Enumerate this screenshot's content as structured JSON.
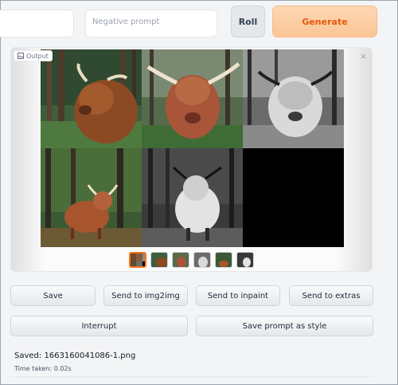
{
  "top_bar": {
    "negative_prompt_placeholder": "Negative prompt",
    "roll_label": "Roll",
    "generate_label": "Generate"
  },
  "output": {
    "label": "Output",
    "close_icon": "×",
    "image_count": 6,
    "selected_thumbnail": 1
  },
  "actions": {
    "save": "Save",
    "send_img2img": "Send to img2img",
    "send_inpaint": "Send to inpaint",
    "send_extras": "Send to extras",
    "interrupt": "Interrupt",
    "save_prompt_style": "Save prompt as style"
  },
  "info": {
    "saved": "Saved: 1663160041086-1.png",
    "time_taken": "Time taken: 0.02s"
  },
  "colors": {
    "generate_bg": "#fbc596",
    "generate_text": "#ea580c",
    "selected_thumb_border": "#f97316"
  }
}
